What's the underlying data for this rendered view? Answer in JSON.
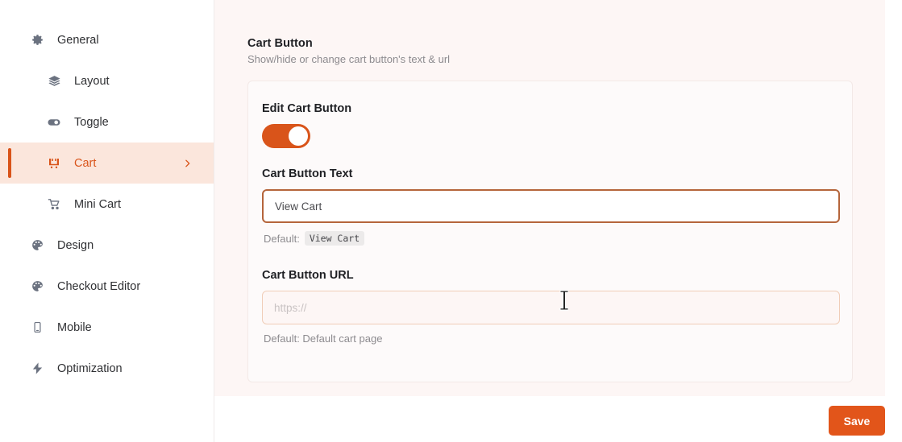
{
  "sidebar": {
    "items": [
      {
        "label": "General",
        "icon": "gear-icon",
        "level": 0,
        "active": false
      },
      {
        "label": "Layout",
        "icon": "layers-icon",
        "level": 1,
        "active": false
      },
      {
        "label": "Toggle",
        "icon": "toggle-icon",
        "level": 1,
        "active": false
      },
      {
        "label": "Cart",
        "icon": "cart-icon",
        "level": 1,
        "active": true
      },
      {
        "label": "Mini Cart",
        "icon": "mini-cart-icon",
        "level": 1,
        "active": false
      },
      {
        "label": "Design",
        "icon": "palette-icon",
        "level": 0,
        "active": false
      },
      {
        "label": "Checkout Editor",
        "icon": "palette-icon",
        "level": 0,
        "active": false
      },
      {
        "label": "Mobile",
        "icon": "mobile-icon",
        "level": 0,
        "active": false
      },
      {
        "label": "Optimization",
        "icon": "lightning-icon",
        "level": 0,
        "active": false
      }
    ]
  },
  "section": {
    "title": "Cart Button",
    "subtitle": "Show/hide or change cart button's text & url"
  },
  "card": {
    "toggle": {
      "label": "Edit Cart Button",
      "state": "on"
    },
    "button_text": {
      "label": "Cart Button Text",
      "value": "View Cart",
      "placeholder": "",
      "default_prefix": "Default:",
      "default_value": "View Cart"
    },
    "button_url": {
      "label": "Cart Button URL",
      "value": "",
      "placeholder": "https://",
      "default_text": "Default: Default cart page"
    }
  },
  "footer": {
    "save_label": "Save"
  },
  "colors": {
    "accent": "#d9541a",
    "save_button": "#e2551a",
    "active_nav_bg": "#fbe6dc",
    "panel_bg": "#fdf6f5",
    "focused_border": "#b5653b"
  }
}
